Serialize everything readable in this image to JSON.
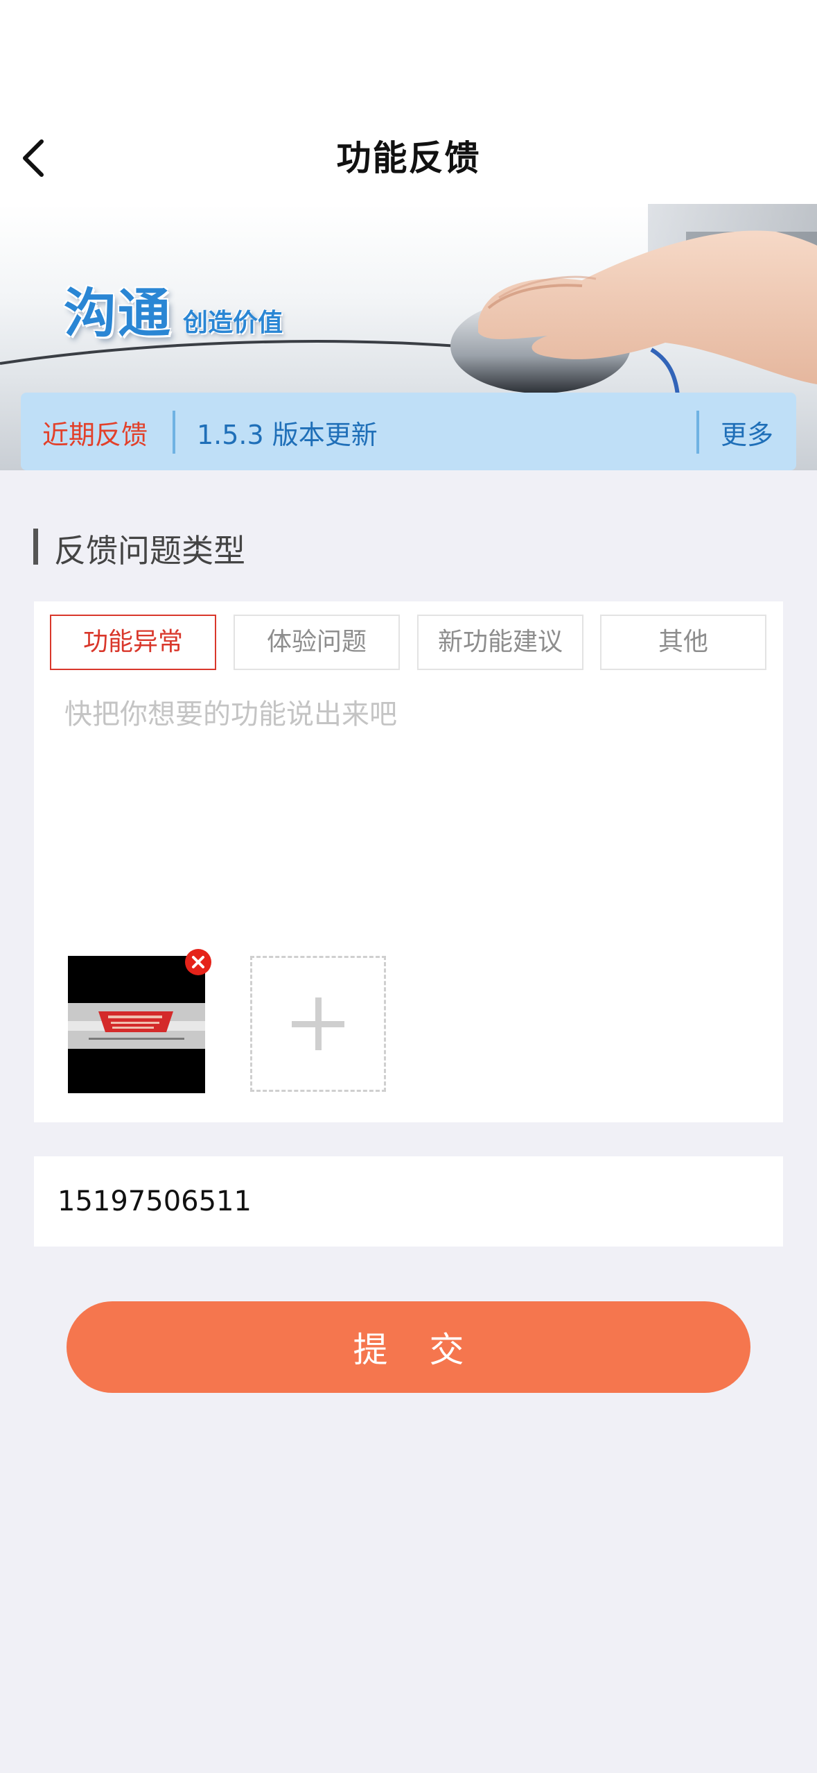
{
  "nav": {
    "title": "功能反馈"
  },
  "banner": {
    "logo_main": "沟通",
    "logo_sub": "创造价值"
  },
  "notice": {
    "label": "近期反馈",
    "text": "1.5.3 版本更新",
    "more": "更多"
  },
  "section": {
    "title": "反馈问题类型"
  },
  "feedback_types": [
    {
      "label": "功能异常",
      "selected": true
    },
    {
      "label": "体验问题",
      "selected": false
    },
    {
      "label": "新功能建议",
      "selected": false
    },
    {
      "label": "其他",
      "selected": false
    }
  ],
  "feedback_input": {
    "placeholder": "快把你想要的功能说出来吧",
    "value": ""
  },
  "contact": {
    "value": "15197506511"
  },
  "submit": {
    "label": "提交"
  },
  "colors": {
    "accent": "#f5764e",
    "selected_tab": "#d9372b",
    "notice_bg": "#bfdff7",
    "link_blue": "#1f6fb8",
    "page_bg": "#f0f0f6"
  },
  "icons": {
    "back": "chevron-left-icon",
    "delete": "close-circle-icon",
    "add": "plus-icon"
  }
}
